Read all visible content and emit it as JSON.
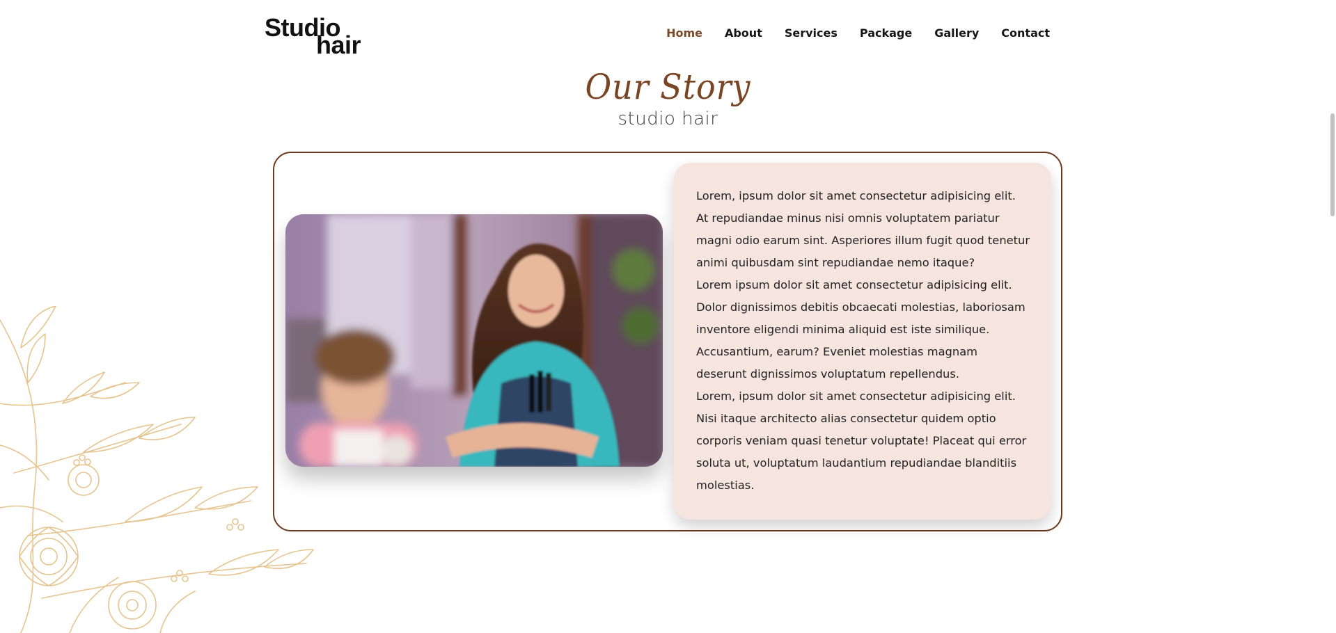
{
  "header": {
    "logo_line1": "Studio",
    "logo_line2": "hair",
    "nav": [
      "Home",
      "About",
      "Services",
      "Package",
      "Gallery",
      "Contact"
    ],
    "active_nav": "Home"
  },
  "section": {
    "title": "Our Story",
    "subtitle": "studio hair",
    "paragraphs": [
      "Lorem, ipsum dolor sit amet consectetur adipisicing elit. At repudiandae minus nisi omnis voluptatem pariatur magni odio earum sint. Asperiores illum fugit quod tenetur animi quibusdam sint repudiandae nemo itaque?",
      "Lorem ipsum dolor sit amet consectetur adipisicing elit. Dolor dignissimos debitis obcaecati molestias, laboriosam inventore eligendi minima aliquid est iste similique. Accusantium, earum? Eveniet molestias magnam deserunt dignissimos voluptatum repellendus.",
      "Lorem, ipsum dolor sit amet consectetur adipisicing elit. Nisi itaque architecto alias consectetur quidem optio corporis veniam quasi tenetur voluptate! Placeat qui error soluta ut, voluptatum laudantium repudiandae blanditiis molestias."
    ]
  },
  "colors": {
    "accent": "#7a4524",
    "frame_border": "#6b3a1f",
    "card_background": "#f6e4de",
    "floral": "#e6c48f"
  },
  "icons": {
    "photo": "salon-hairdresser-photo",
    "decoration": "floral-illustration"
  }
}
